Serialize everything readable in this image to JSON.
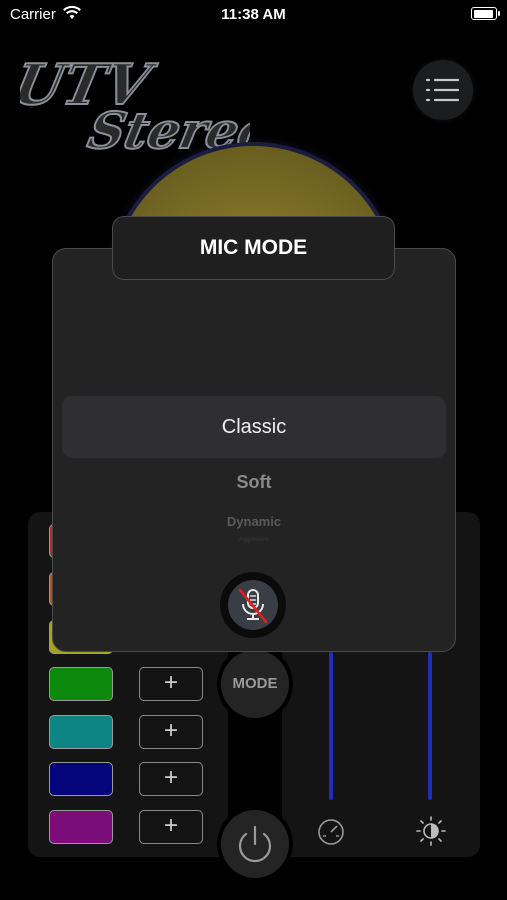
{
  "status_bar": {
    "carrier": "Carrier",
    "time": "11:38 AM",
    "battery_level": 0.95
  },
  "logo": {
    "text": "UTV Stereo"
  },
  "menu": {
    "icon": "list-menu-icon"
  },
  "modal": {
    "title": "MIC MODE",
    "options": [
      "Classic",
      "Soft",
      "Dynamic",
      "Aggressive"
    ],
    "selected": "Classic",
    "mic_icon": "mic-off-icon"
  },
  "controls": {
    "mode_label": "MODE",
    "power_icon": "power-icon",
    "speed_icon": "speedometer-icon",
    "brightness_icon": "brightness-icon"
  },
  "color_slots": [
    {
      "color": "#b22a2a",
      "add_label": "+"
    },
    {
      "color": "#b0522a",
      "add_label": "+"
    },
    {
      "color": "#a8a020",
      "add_label": "+"
    },
    {
      "color": "#0d8a0d",
      "add_label": "+"
    },
    {
      "color": "#0d8585",
      "add_label": "+"
    },
    {
      "color": "#05057a",
      "add_label": "+"
    },
    {
      "color": "#7a0d7a",
      "add_label": "+"
    }
  ],
  "colors": {
    "wheel": "#8a7a30",
    "slider_track": "#1e2fb8",
    "mic_slash": "#e02020"
  }
}
